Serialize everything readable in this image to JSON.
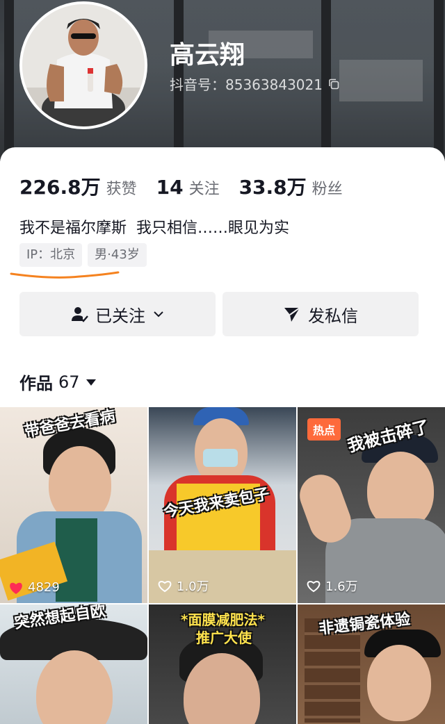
{
  "profile": {
    "nickname": "高云翔",
    "douyin_id": "抖音号：85363843021",
    "bio": "我不是福尔摩斯  我只相信……眼见为实",
    "tags": [
      "IP：北京",
      "男·43岁"
    ]
  },
  "stats": [
    {
      "value": "226.8万",
      "label": "获赞"
    },
    {
      "value": "14",
      "label": "关注"
    },
    {
      "value": "33.8万",
      "label": "粉丝"
    }
  ],
  "buttons": {
    "follow_label": "已关注",
    "message_label": "发私信"
  },
  "works": {
    "title": "作品",
    "count": "67"
  },
  "videos": [
    {
      "caption": "带爸爸去看病",
      "likes": "4829",
      "liked": true
    },
    {
      "caption": "今天我来卖包子",
      "likes": "1.0万",
      "liked": false
    },
    {
      "caption": "我被击碎了",
      "likes": "1.6万",
      "liked": false,
      "badge": "热点"
    },
    {
      "caption": "突然想起自欧",
      "likes": "",
      "liked": false
    },
    {
      "caption": "*面膜减肥法*",
      "caption2": "推广大使",
      "likes": "",
      "liked": false
    },
    {
      "caption": "非遗锔瓷体验",
      "likes": "",
      "liked": false
    }
  ],
  "colors": {
    "like_red": "#fe2c55",
    "annotation_orange": "#f5821f",
    "hot_badge": "#fe6a3b"
  }
}
